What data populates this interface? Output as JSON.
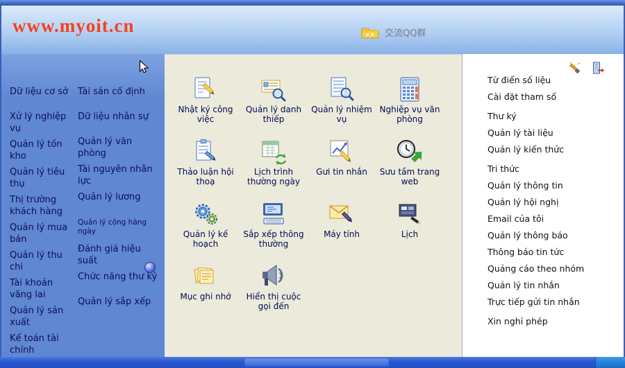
{
  "header": {
    "site_url": "www.myoit.cn",
    "qq_group_label": "交流QQ群"
  },
  "sidebar": {
    "col1": [
      "Dữ liệu cơ sở",
      "Xử lý nghiệp vụ",
      "Quản lý tồn kho",
      "Quản lý tiêu thụ",
      "Thị trường khách hàng",
      "Quản lý mua bán",
      "Quản lý thu chi",
      "Tài khoản vãng lai",
      "Quản lý sản xuất",
      "Kế toán tài chính"
    ],
    "col2": [
      "Tài sản cố định",
      "Dữ liệu nhân sự",
      "Quản lý văn phòng",
      "Tài nguyên nhân lực",
      "Quản lý lương",
      "Quản lý công hàng ngày",
      "Đánh giá hiệu suất",
      "Chức năng thư ký",
      "Quản lý sắp xếp"
    ]
  },
  "main": {
    "items": [
      {
        "label": "Nhật ký công việc",
        "icon": "journal"
      },
      {
        "label": "Quản lý danh thiếp",
        "icon": "card"
      },
      {
        "label": "Quản lý nhiệm vụ",
        "icon": "task"
      },
      {
        "label": "Nghiệp vụ văn phòng",
        "icon": "calc"
      },
      {
        "label": "Thảo luận hội thoạ",
        "icon": "discuss"
      },
      {
        "label": "Lịch trình thường ngày",
        "icon": "schedule"
      },
      {
        "label": "Gưi tin nhắn",
        "icon": "message"
      },
      {
        "label": "Sưu tầm trang web",
        "icon": "webclock"
      },
      {
        "label": "Quản lý kế hoạch",
        "icon": "gears"
      },
      {
        "label": "Sắp xếp thông thường",
        "icon": "computer"
      },
      {
        "label": "Máy tính",
        "icon": "envelope"
      },
      {
        "label": "Lịch",
        "icon": "board"
      },
      {
        "label": "Mục ghi nhớ",
        "icon": "notes"
      },
      {
        "label": "Hiển thị cuộc gọi đến",
        "icon": "megaphone"
      }
    ]
  },
  "right_panel": {
    "groups": [
      {
        "items": [
          "Từ điển số liệu",
          "Cài đặt tham số"
        ]
      },
      {
        "items": [
          "Thư ký",
          "Quản lý tài liệu",
          "Quản lý kiến thức"
        ]
      },
      {
        "items": [
          "Tri thức",
          "Quản lý thông tin",
          "Quản lý hội nghị",
          "Email của tôi",
          "Quản lý thông báo",
          "Thông báo tin tức",
          "Quảng cáo theo nhóm",
          "Quản lý tin nhắn",
          "Trực tiếp gửi tin nhắn"
        ]
      },
      {
        "items": [
          "Xin nghỉ phép"
        ]
      }
    ]
  },
  "icons": {
    "qq_folder": "folder",
    "magic_wand": "wand",
    "exit_door": "exit",
    "mouse_cursor": "cursor"
  },
  "colors": {
    "brand_red": "#f8401e",
    "sidebar_blue": "#5f87d2",
    "desktop_beige": "#eceadb",
    "taskbar_blue": "#2a56cc"
  }
}
